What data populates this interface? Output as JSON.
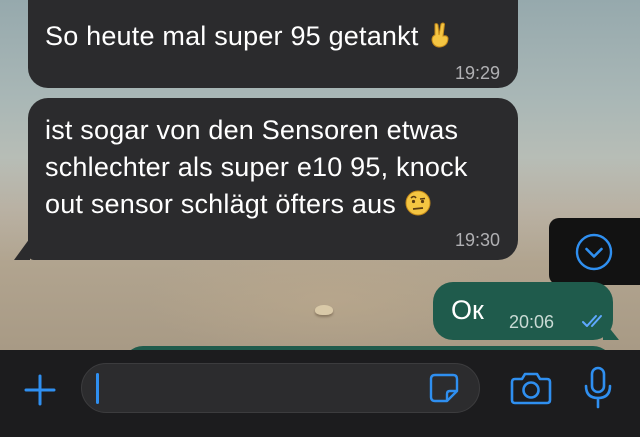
{
  "messages": [
    {
      "direction": "incoming",
      "text": "So heute mal super 95 getankt",
      "emoji": "victory-hand",
      "time": "19:29"
    },
    {
      "direction": "incoming",
      "lines": [
        "ist sogar von den Sensoren etwas",
        "schlechter als super e10 95, knock",
        "out sensor schlägt öfters aus"
      ],
      "emoji": "raised-eyebrow-face",
      "time": "19:30"
    },
    {
      "direction": "outgoing",
      "text": "Ок",
      "time": "20:06",
      "status": "read"
    }
  ],
  "input_bar": {
    "placeholder": "",
    "value": "",
    "icons": [
      "plus-icon",
      "sticker-icon",
      "camera-icon",
      "microphone-icon"
    ]
  },
  "scroll_button": {
    "icon": "chevron-down-icon"
  },
  "colors": {
    "incoming_bubble": "#2b2b2d",
    "outgoing_bubble": "#1f5b4c",
    "accent": "#2f8ff0",
    "input_bar": "#1c1c1e"
  }
}
